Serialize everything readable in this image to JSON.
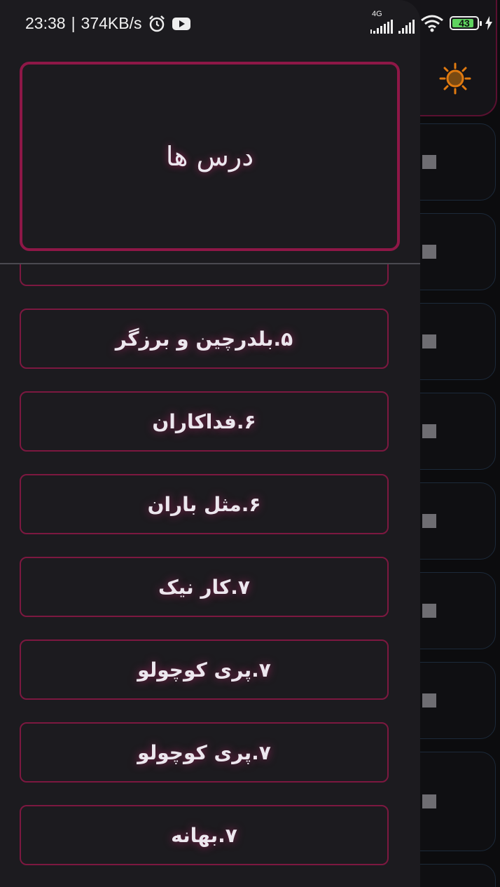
{
  "status_bar": {
    "time": "23:38",
    "speed": "374KB/s",
    "network": "4G",
    "battery": "43"
  },
  "drawer": {
    "title": "درس ها",
    "lessons": [
      {
        "label": ""
      },
      {
        "label": "۵.بلدرچین و برزگر"
      },
      {
        "label": "۶.فداکاران"
      },
      {
        "label": "۶.مثل باران"
      },
      {
        "label": "۷.کار نیک"
      },
      {
        "label": "۷.پری کوچولو"
      },
      {
        "label": "۷.پری کوچولو"
      },
      {
        "label": "۷.بهانه"
      }
    ]
  },
  "background_app": {
    "theme_toggle_icon": "sun-icon"
  },
  "colors": {
    "accent": "#8e1747",
    "drawer_bg": "#1c1b1f",
    "sun": "#e07a10"
  }
}
